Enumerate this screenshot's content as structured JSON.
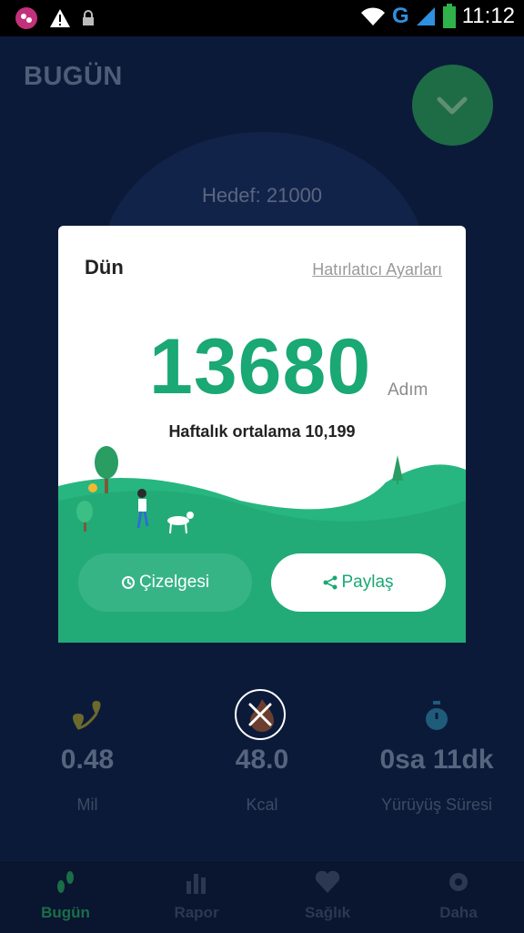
{
  "status_bar": {
    "time": "11:12",
    "network": "G",
    "icons": [
      "app-notification-icon",
      "warning-icon",
      "lock-icon",
      "wifi-icon",
      "signal-icon",
      "battery-icon"
    ]
  },
  "background": {
    "title": "BUGÜN",
    "target_label": "Hedef: 21000",
    "stats": [
      {
        "value": "0.48",
        "label": "Mil",
        "icon": "map-pin-icon"
      },
      {
        "value": "48.0",
        "label": "Kcal",
        "icon": "flame-icon"
      },
      {
        "value": "0sa 11dk",
        "label": "Yürüyüş Süresi",
        "icon": "stopwatch-icon"
      }
    ],
    "nav": [
      {
        "label": "Bugün",
        "icon": "footsteps-icon",
        "active": true
      },
      {
        "label": "Rapor",
        "icon": "bar-chart-icon",
        "active": false
      },
      {
        "label": "Sağlık",
        "icon": "heart-pulse-icon",
        "active": false
      },
      {
        "label": "Daha",
        "icon": "gear-icon",
        "active": false
      }
    ]
  },
  "modal": {
    "title": "Dün",
    "reminder_link": "Hatırlatıcı Ayarları",
    "steps": "13680",
    "steps_unit": "Adım",
    "weekly_average": "Haftalık ortalama 10,199",
    "chart_button": "Çizelgesi",
    "share_button": "Paylaş"
  },
  "colors": {
    "accent": "#1aa874",
    "button_green": "#37b486",
    "overlay_bg": "#0c1a3a"
  }
}
